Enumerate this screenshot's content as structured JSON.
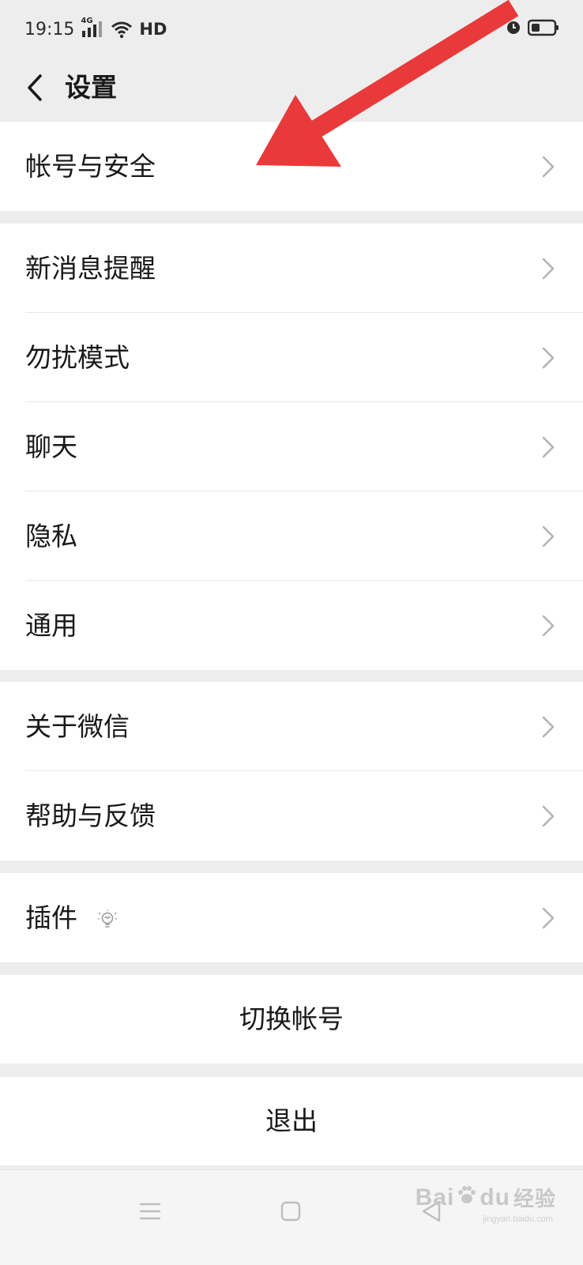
{
  "status_bar": {
    "time": "19:15",
    "network": "4G",
    "hd": "HD",
    "icons": [
      "signal-icon",
      "wifi-icon",
      "alarm-icon",
      "battery-icon"
    ]
  },
  "nav": {
    "title": "设置",
    "back_icon": "chevron-left-icon"
  },
  "groups": {
    "account": {
      "items": [
        {
          "label": "帐号与安全"
        }
      ]
    },
    "main": {
      "items": [
        {
          "label": "新消息提醒"
        },
        {
          "label": "勿扰模式"
        },
        {
          "label": "聊天"
        },
        {
          "label": "隐私"
        },
        {
          "label": "通用"
        }
      ]
    },
    "about": {
      "items": [
        {
          "label": "关于微信"
        },
        {
          "label": "帮助与反馈"
        }
      ]
    },
    "plugins": {
      "items": [
        {
          "label": "插件",
          "icon": "lightbulb-icon"
        }
      ]
    }
  },
  "actions": {
    "switch_account": "切换帐号",
    "logout": "退出"
  },
  "system_nav": {
    "icons": [
      "menu-icon",
      "home-icon",
      "back-triangle-icon"
    ]
  },
  "watermark": {
    "text_left": "Bai",
    "text_right": "du",
    "text_cn": "经验",
    "sub": "jingyan.baidu.com"
  },
  "colors": {
    "background": "#ededed",
    "card": "#ffffff",
    "text": "#191919",
    "chevron": "#b2b2b2",
    "arrow": "#e83a3a"
  }
}
